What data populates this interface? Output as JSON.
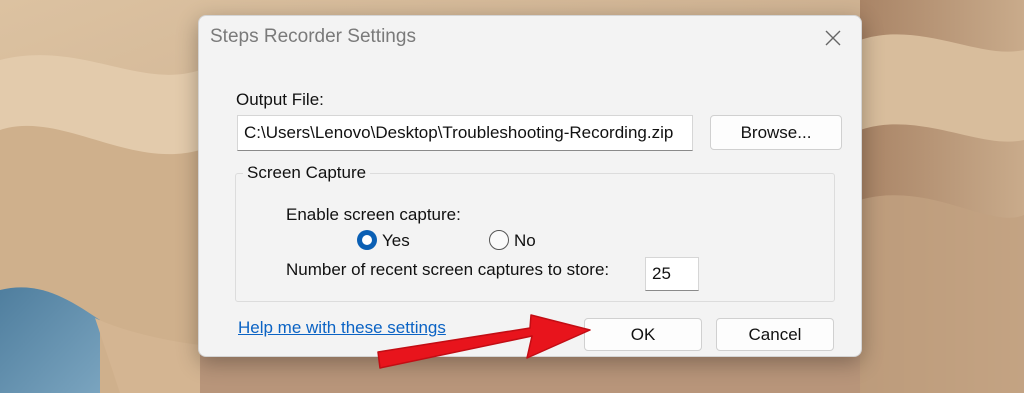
{
  "dialog": {
    "title": "Steps Recorder Settings",
    "output_file_label": "Output File:",
    "output_file_value": "C:\\Users\\Lenovo\\Desktop\\Troubleshooting-Recording.zip",
    "browse_label": "Browse...",
    "screen_capture_group": "Screen Capture",
    "enable_capture_label": "Enable screen capture:",
    "yes_label": "Yes",
    "no_label": "No",
    "enable_capture_selected": "Yes",
    "recent_captures_label": "Number of recent screen captures to store:",
    "recent_captures_value": "25",
    "help_link": "Help me with these settings",
    "ok_label": "OK",
    "cancel_label": "Cancel"
  },
  "icons": {
    "close": "close-icon",
    "arrow": "red-arrow-annotation"
  },
  "colors": {
    "accent": "#0a5fb4",
    "link": "#0b63c4",
    "arrow": "#e8141c",
    "dialog_bg": "#f3f3f3"
  }
}
